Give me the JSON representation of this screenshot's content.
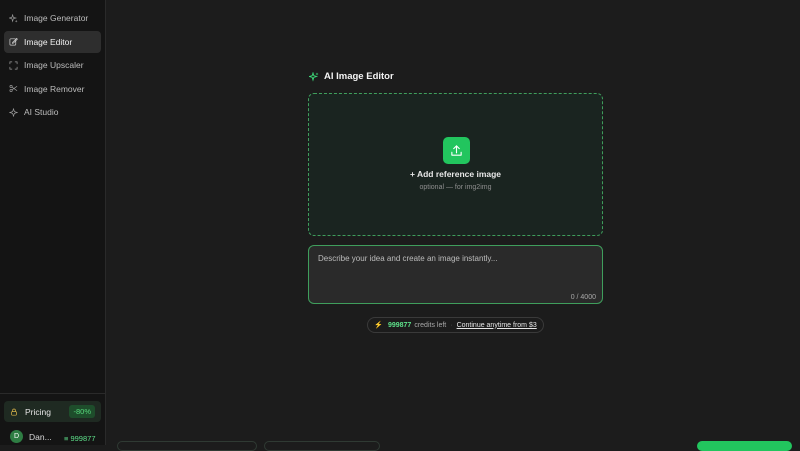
{
  "sidebar": {
    "items": [
      {
        "label": "Image Generator",
        "icon": "sparkle-icon",
        "active": false
      },
      {
        "label": "Image Editor",
        "icon": "edit-icon",
        "active": true
      },
      {
        "label": "Image Upscaler",
        "icon": "expand-icon",
        "active": false
      },
      {
        "label": "Image Remover",
        "icon": "scissors-icon",
        "active": false
      },
      {
        "label": "AI Studio",
        "icon": "star-icon",
        "active": false
      }
    ],
    "pricing": {
      "label": "Pricing",
      "badge": "-80%",
      "icon": "lock-icon"
    },
    "user": {
      "initial": "D",
      "name": "Dan...",
      "credits": "≡ 999877"
    }
  },
  "editor": {
    "title": "AI Image Editor",
    "dropzone": {
      "title": "+ Add reference image",
      "subtitle": "optional — for img2img"
    },
    "prompt": {
      "placeholder": "Describe your idea and create an image instantly...",
      "value": "",
      "counter": "0 / 4000"
    },
    "credits": {
      "count": "999877",
      "text": "credits left",
      "separator": "·",
      "cta": "Continue anytime from $3"
    }
  },
  "colors": {
    "accent": "#22c55e",
    "background": "#1c1c1c",
    "sidebar": "#141414"
  }
}
